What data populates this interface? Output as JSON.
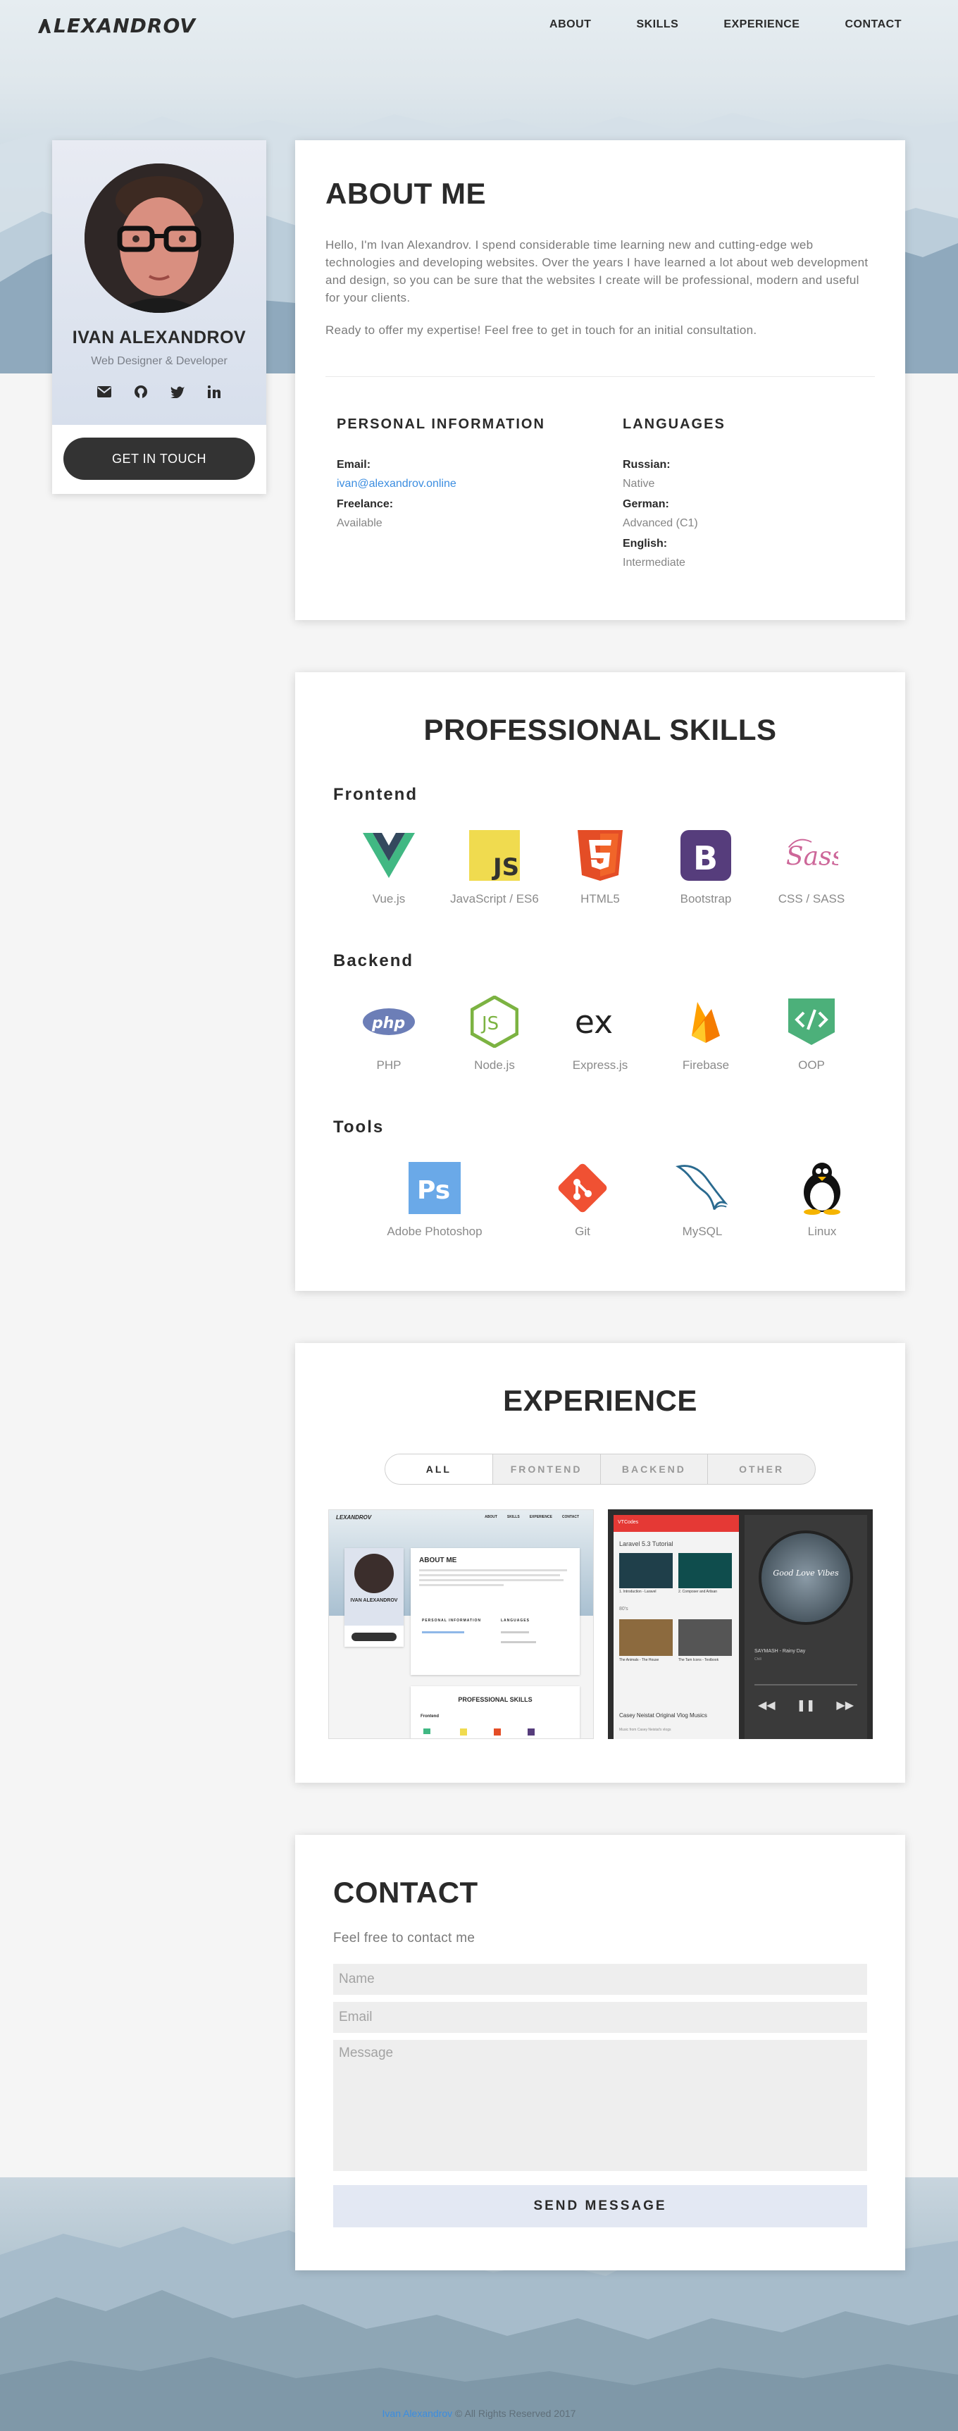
{
  "nav": {
    "logo": "LEXANDROV",
    "links": [
      "ABOUT",
      "SKILLS",
      "EXPERIENCE",
      "CONTACT"
    ]
  },
  "profile": {
    "name": "IVAN ALEXANDROV",
    "role": "Web Designer & Developer",
    "social": [
      "envelope-icon",
      "github-icon",
      "twitter-icon",
      "linkedin-icon"
    ],
    "button": "GET IN TOUCH"
  },
  "about": {
    "title": "ABOUT ME",
    "p1": "Hello, I'm Ivan Alexandrov. I spend considerable time learning new and cutting-edge web technologies and developing websites. Over the years I have learned a lot about web development and design, so you can be sure that the websites I create will be professional, modern and useful for your clients.",
    "p2": "Ready to offer my expertise! Feel free to get in touch for an initial consultation.",
    "personal_title": "PERSONAL  INFORMATION",
    "languages_title": "LANGUAGES",
    "email_label": "Email:",
    "email_value": "ivan@alexandrov.online",
    "freelance_label": "Freelance:",
    "freelance_value": "Available",
    "languages": [
      {
        "label": "Russian:",
        "value": "Native"
      },
      {
        "label": "German:",
        "value": "Advanced (C1)"
      },
      {
        "label": "English:",
        "value": "Intermediate"
      }
    ]
  },
  "skills": {
    "title": "PROFESSIONAL SKILLS",
    "frontend_title": "Frontend",
    "backend_title": "Backend",
    "tools_title": "Tools",
    "frontend": [
      "Vue.js",
      "JavaScript / ES6",
      "HTML5",
      "Bootstrap",
      "CSS / SASS"
    ],
    "backend": [
      "PHP",
      "Node.js",
      "Express.js",
      "Firebase",
      "OOP"
    ],
    "tools": [
      "Adobe Photoshop",
      "Git",
      "MySQL",
      "Linux"
    ]
  },
  "experience": {
    "title": "EXPERIENCE",
    "tabs": [
      "ALL",
      "FRONTEND",
      "BACKEND",
      "OTHER"
    ],
    "active_tab": "ALL",
    "shot1": {
      "logo": "LEXANDROV",
      "nav": [
        "ABOUT",
        "SKILLS",
        "EXPERIENCE",
        "CONTACT"
      ],
      "name": "IVAN ALEXANDROV",
      "about_title": "ABOUT ME",
      "personal_title": "PERSONAL INFORMATION",
      "languages_title": "LANGUAGES",
      "skills_title": "PROFESSIONAL SKILLS",
      "frontend": "Frontend"
    },
    "shot2": {
      "header": "VTCodes",
      "video_title": "Laravel 5.3 Tutorial",
      "caption1": "1. Introduction - Laravel",
      "caption2": "2. Composer and Artisan",
      "section2": "80's",
      "caption3": "The Animals - The House",
      "caption4": "The Tam Icons - Textbook",
      "video2_title": "Casey Neistat Original Vlog Musics",
      "video2_sub": "Music from Casey Neistat's vlogs",
      "player_text": "Good Love Vibes",
      "track": "SAYMASH - Rainy Day",
      "track_sub": "Chill"
    }
  },
  "contact": {
    "title": "CONTACT",
    "subtitle": "Feel free to contact me",
    "name_placeholder": "Name",
    "email_placeholder": "Email",
    "message_placeholder": "Message",
    "button": "SEND MESSAGE"
  },
  "footer": {
    "link": "Ivan Alexandrov",
    "text": " © All Rights Reserved 2017"
  },
  "colors": {
    "accent_link": "#3b8de0",
    "dark_button": "#333333",
    "send_button": "#e3e8f3"
  }
}
